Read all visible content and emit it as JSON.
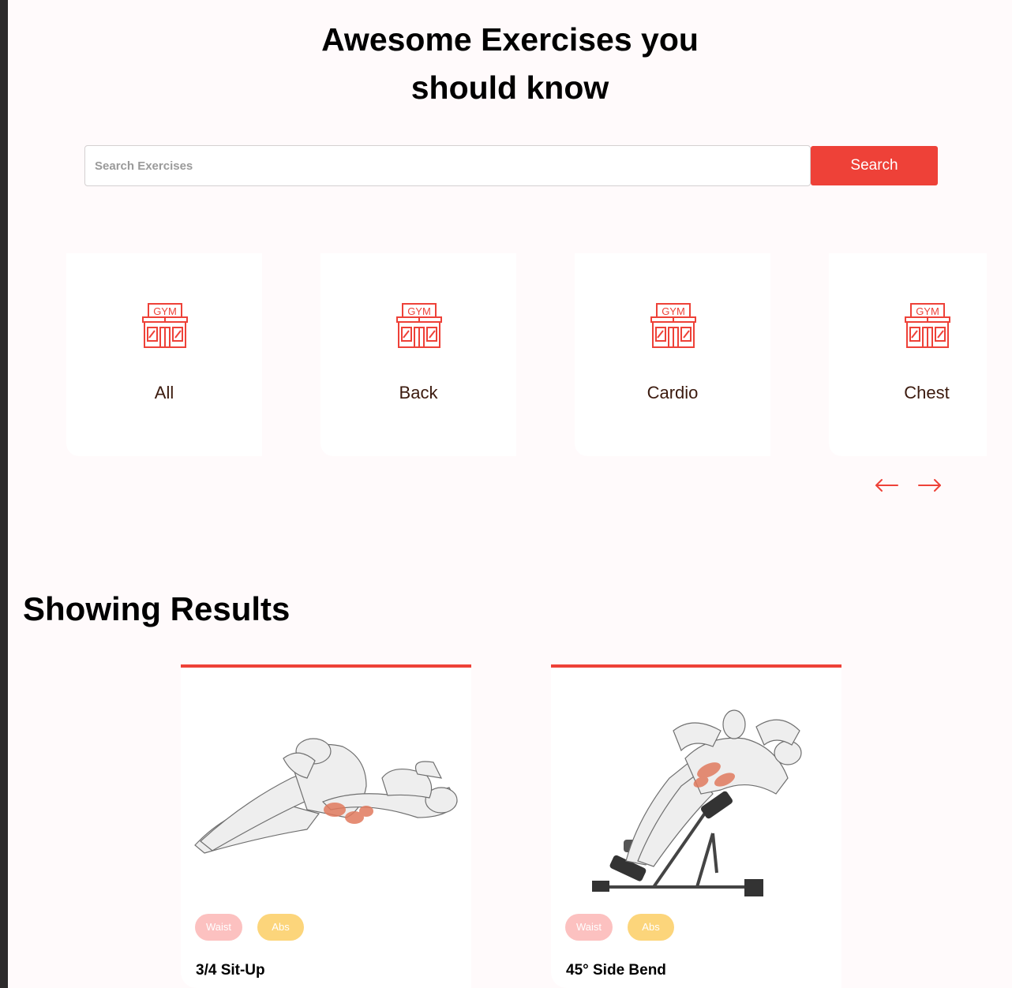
{
  "hero": {
    "title_line1": "Awesome Exercises you",
    "title_line2": "should know"
  },
  "search": {
    "placeholder": "Search Exercises",
    "value": "",
    "button_label": "Search"
  },
  "categories": [
    {
      "label": "All",
      "icon": "gym-icon"
    },
    {
      "label": "Back",
      "icon": "gym-icon"
    },
    {
      "label": "Cardio",
      "icon": "gym-icon"
    },
    {
      "label": "Chest",
      "icon": "gym-icon"
    }
  ],
  "carousel": {
    "prev_icon": "arrow-left-icon",
    "next_icon": "arrow-right-icon"
  },
  "results": {
    "title": "Showing Results",
    "exercises": [
      {
        "name": "3/4 Sit-Up",
        "body_part": "Waist",
        "target": "Abs"
      },
      {
        "name": "45° Side Bend",
        "body_part": "Waist",
        "target": "Abs"
      }
    ]
  },
  "colors": {
    "accent": "#ee4138",
    "background": "#fffafb",
    "tag_body_part": "#fcc1c0",
    "tag_target": "#fcd57b",
    "category_label": "#3b1a0e"
  }
}
